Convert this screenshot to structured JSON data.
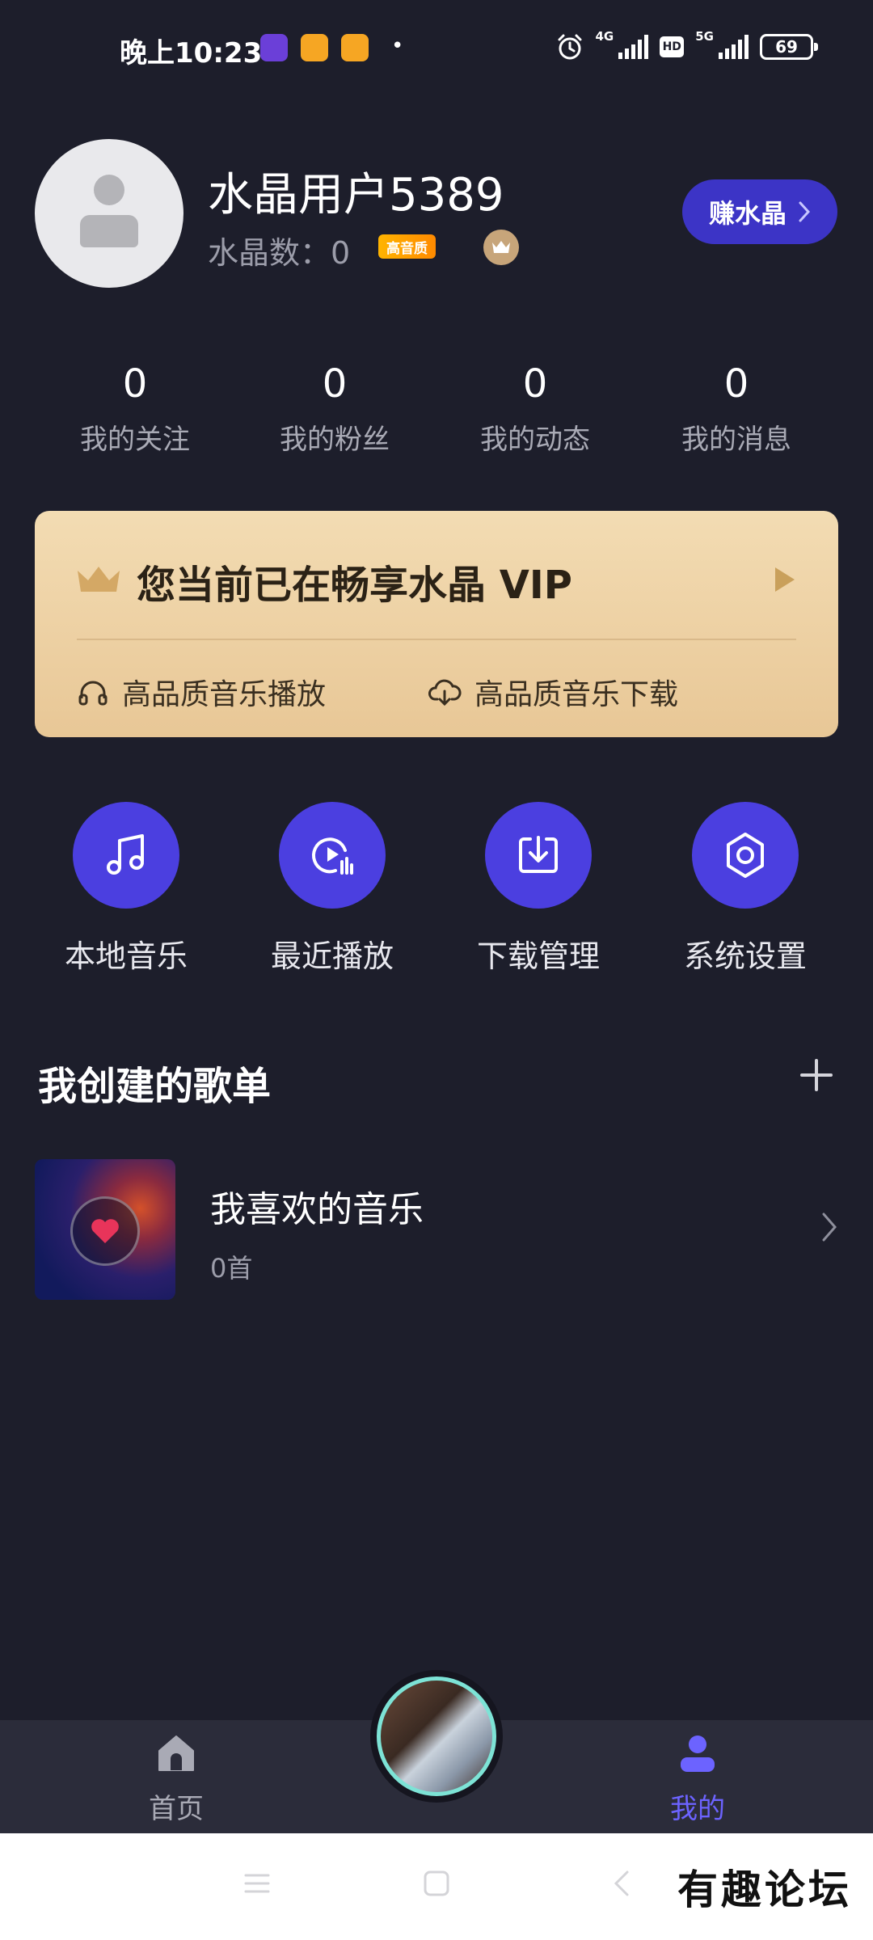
{
  "status_bar": {
    "time": "晚上10:23",
    "network_1": "4G",
    "hd": "HD",
    "network_2": "5G",
    "battery": "69"
  },
  "profile": {
    "username": "水晶用户5389",
    "crystal_count": "水晶数：0",
    "hq_badge": "高音质",
    "earn_button": "赚水晶"
  },
  "stats": [
    {
      "value": "0",
      "label": "我的关注"
    },
    {
      "value": "0",
      "label": "我的粉丝"
    },
    {
      "value": "0",
      "label": "我的动态"
    },
    {
      "value": "0",
      "label": "我的消息"
    }
  ],
  "vip": {
    "title": "您当前已在畅享水晶 VIP",
    "feature_1": "高品质音乐播放",
    "feature_2": "高品质音乐下载",
    "accent": "#c9a05b"
  },
  "actions": [
    {
      "label": "本地音乐",
      "icon": "music-note-icon"
    },
    {
      "label": "最近播放",
      "icon": "recent-play-icon"
    },
    {
      "label": "下载管理",
      "icon": "download-icon"
    },
    {
      "label": "系统设置",
      "icon": "gear-icon"
    }
  ],
  "playlists": {
    "section_title": "我创建的歌单",
    "items": [
      {
        "name": "我喜欢的音乐",
        "count": "0首"
      }
    ]
  },
  "bottom_nav": {
    "home": "首页",
    "mine": "我的",
    "active_color": "#6c63ff",
    "inactive_color": "#a9aab5"
  },
  "watermark": "有趣论坛",
  "colors": {
    "background": "#1d1e2b",
    "accent": "#4b3fe0"
  }
}
